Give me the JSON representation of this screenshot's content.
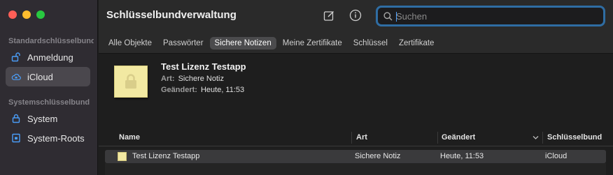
{
  "sidebar": {
    "section_default": "Standardschlüsselbund",
    "section_system": "Systemschlüsselbund",
    "items": [
      {
        "label": "Anmeldung",
        "icon": "unlocked-lock-icon"
      },
      {
        "label": "iCloud",
        "icon": "cloud-lock-icon",
        "selected": true
      },
      {
        "label": "System",
        "icon": "lock-icon"
      },
      {
        "label": "System-Roots",
        "icon": "cabinet-lock-icon"
      }
    ]
  },
  "toolbar": {
    "title": "Schlüsselbundverwaltung",
    "search_placeholder": "Suchen"
  },
  "tabs": [
    "Alle Objekte",
    "Passwörter",
    "Sichere Notizen",
    "Meine Zertifikate",
    "Schlüssel",
    "Zertifikate"
  ],
  "active_tab": "Sichere Notizen",
  "detail": {
    "title": "Test Lizenz Testapp",
    "kind_label": "Art:",
    "kind_value": "Sichere Notiz",
    "modified_label": "Geändert:",
    "modified_value": "Heute, 11:53"
  },
  "table": {
    "columns": {
      "name": "Name",
      "kind": "Art",
      "modified": "Geändert",
      "keychain": "Schlüsselbund"
    },
    "rows": [
      {
        "name": "Test Lizenz Testapp",
        "kind": "Sichere Notiz",
        "modified": "Heute, 11:53",
        "keychain": "iCloud"
      }
    ]
  },
  "colors": {
    "accent": "#2f6da3",
    "link_blue": "#4ea2ff",
    "note_yellow": "#f2e9a2"
  }
}
